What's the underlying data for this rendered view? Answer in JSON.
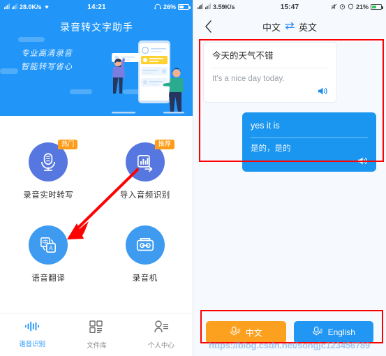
{
  "left_phone": {
    "status_bar": {
      "network_speed": "28.0K/s",
      "time": "14:21",
      "battery_percent": "26%",
      "icons": [
        "signal-icon",
        "signal-icon",
        "wifi-icon",
        "headphone-icon",
        "battery-icon"
      ]
    },
    "hero": {
      "title": "录音转文字助手",
      "subtitle_line1": "专业高清录音",
      "subtitle_line2": "智能转写省心",
      "bg_color": "#2196f8"
    },
    "features": [
      {
        "label": "录音实时转写",
        "badge": "热门",
        "icon": "microphone-document-icon",
        "circle_color": "#5777e0"
      },
      {
        "label": "导入音频识别",
        "badge": "推荐",
        "icon": "waveform-import-icon",
        "circle_color": "#5777e0"
      },
      {
        "label": "语音翻译",
        "badge": "",
        "icon": "translate-icon",
        "circle_color": "#3e9bf0"
      },
      {
        "label": "录音机",
        "badge": "",
        "icon": "cassette-tape-icon",
        "circle_color": "#3e9bf0"
      }
    ],
    "tabbar": [
      {
        "label": "语音识别",
        "icon": "waveform-icon",
        "active": true
      },
      {
        "label": "文件库",
        "icon": "grid-list-icon",
        "active": false
      },
      {
        "label": "个人中心",
        "icon": "person-icon",
        "active": false
      }
    ]
  },
  "right_phone": {
    "status_bar": {
      "network_speed": "3.59K/s",
      "time": "15:47",
      "battery_percent": "21%",
      "icons": [
        "signal-icon",
        "signal-icon",
        "mute-icon",
        "alarm-icon",
        "shield-icon",
        "battery-charging-icon"
      ]
    },
    "nav": {
      "back_icon": "chevron-left-icon",
      "source_language": "中文",
      "swap_icon": "swap-horizontal-icon",
      "target_language": "英文"
    },
    "messages": [
      {
        "side": "left",
        "primary": "今天的天气不错",
        "secondary": "It's a nice day today.",
        "speaker_icon": "speaker-icon",
        "bubble_color": "#ffffff"
      },
      {
        "side": "right",
        "primary": "yes it is",
        "secondary": "是的，是的",
        "speaker_icon": "speaker-icon",
        "bubble_color": "#1a96f0"
      }
    ],
    "buttons": [
      {
        "label": "中文",
        "icon": "microphone-icon",
        "color": "#fca11f"
      },
      {
        "label": "English",
        "icon": "microphone-icon",
        "color": "#2196f3"
      }
    ]
  },
  "annotations": {
    "arrow_color": "#ff0000",
    "box_color": "#ff0000"
  },
  "watermark": "https://blog.csdn.net/songjc123456789"
}
